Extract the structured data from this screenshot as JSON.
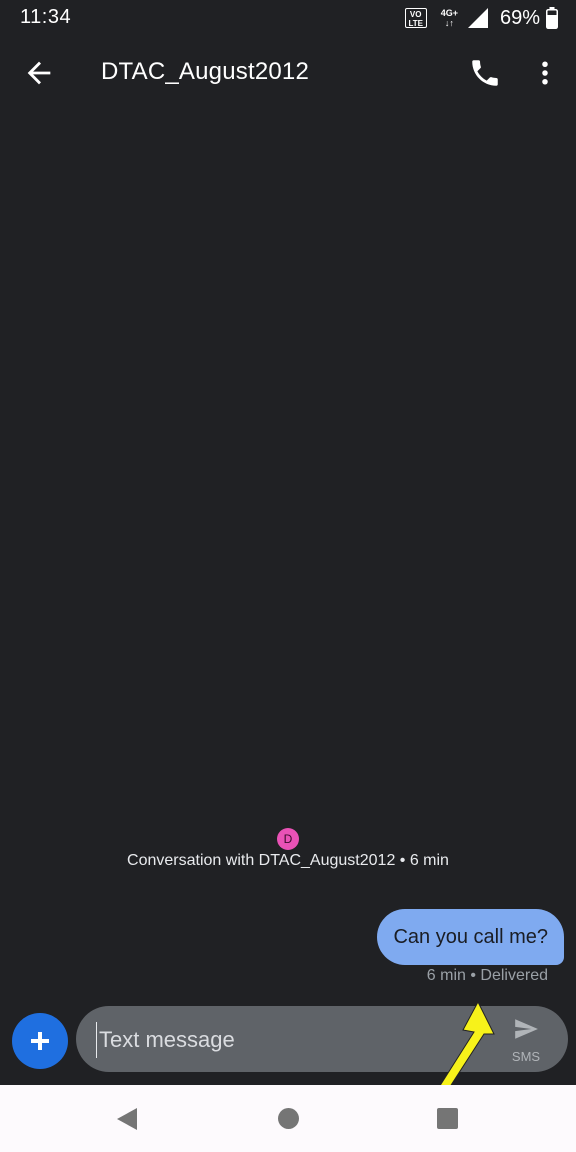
{
  "status_bar": {
    "time": "11:34",
    "volte_top": "VO",
    "volte_bottom": "LTE",
    "network": "4G+",
    "battery": "69%"
  },
  "app_bar": {
    "title": "DTAC_August2012"
  },
  "conversation": {
    "avatar_letter": "D",
    "avatar_color": "#e952b6",
    "header": "Conversation with DTAC_August2012 • 6 min",
    "messages": [
      {
        "text": "Can you call me?",
        "meta": "6 min • Delivered"
      }
    ]
  },
  "compose": {
    "placeholder": "Text message",
    "send_label": "SMS"
  },
  "colors": {
    "background": "#202124",
    "bubble": "#7faaf0",
    "fab": "#1f6fe0",
    "annotation": "#f7f21a"
  }
}
